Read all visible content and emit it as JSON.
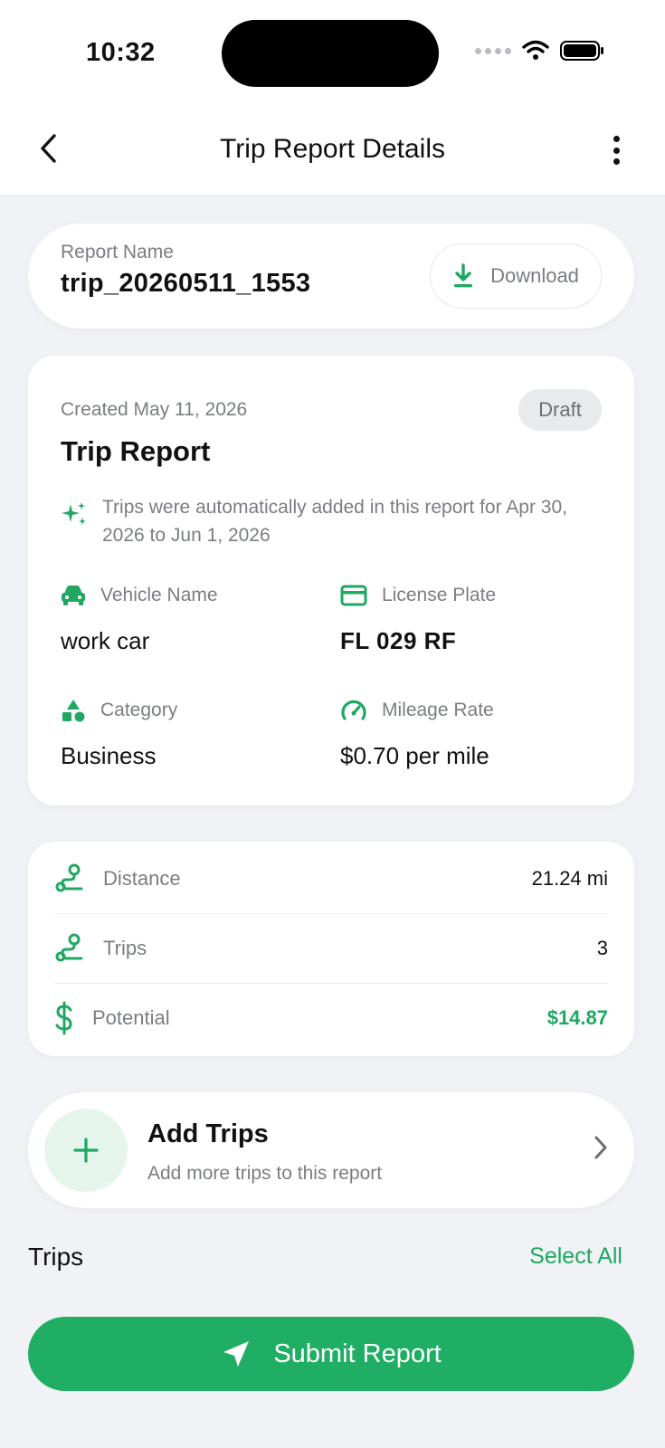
{
  "status_bar": {
    "time": "10:32"
  },
  "header": {
    "title": "Trip Report Details"
  },
  "report_name": {
    "label": "Report Name",
    "value": "trip_20260511_1553",
    "download_label": "Download"
  },
  "report": {
    "created": "Created May 11, 2026",
    "status_badge": "Draft",
    "title": "Trip Report",
    "auto_note": "Trips were automatically added in this report for Apr 30, 2026 to Jun 1, 2026",
    "vehicle_label": "Vehicle Name",
    "vehicle_value": "work car",
    "plate_label": "License Plate",
    "plate_value": "FL 029 RF",
    "category_label": "Category",
    "category_value": "Business",
    "rate_label": "Mileage Rate",
    "rate_value": "$0.70 per mile"
  },
  "stats": {
    "distance_label": "Distance",
    "distance_value": "21.24 mi",
    "trips_label": "Trips",
    "trips_value": "3",
    "potential_label": "Potential",
    "potential_value": "$14.87"
  },
  "add_trips": {
    "title": "Add Trips",
    "subtitle": "Add more trips to this report"
  },
  "trips_section": {
    "heading": "Trips",
    "select_all": "Select All"
  },
  "submit": {
    "label": "Submit Report"
  },
  "colors": {
    "accent": "#1fae64",
    "background": "#f1f2f5",
    "muted": "#7a7d83"
  }
}
